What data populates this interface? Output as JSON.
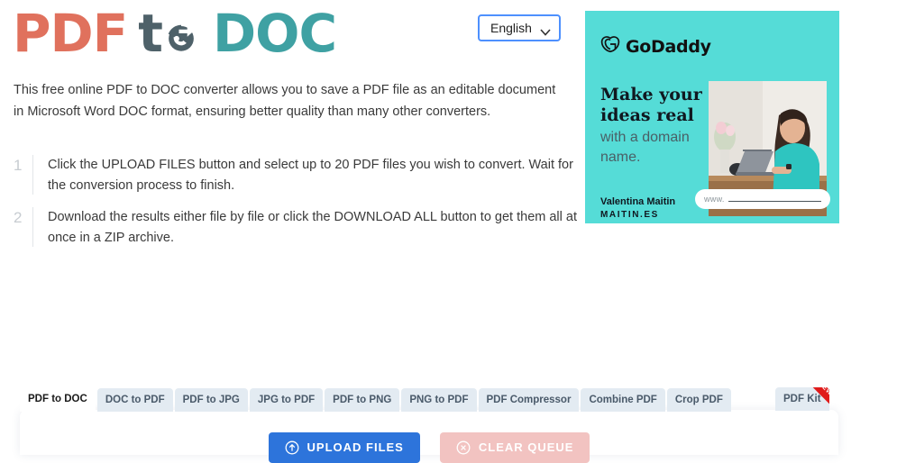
{
  "header": {
    "logo": {
      "part1": "PDF",
      "part2": "t",
      "icon": "convert-circle-icon",
      "part3": "DOC"
    },
    "language": {
      "selected": "English",
      "options": [
        "English"
      ],
      "caret": "˅"
    }
  },
  "intro": {
    "paragraph": "This free online PDF to DOC converter allows you to save a PDF file as an editable document in Microsoft Word DOC format, ensuring better quality than many other converters."
  },
  "steps": [
    {
      "number": "1",
      "text": "Click the UPLOAD FILES button and select up to 20 PDF files you wish to convert. Wait for the conversion process to finish."
    },
    {
      "number": "2",
      "text": "Download the results either file by file or click the DOWNLOAD ALL button to get them all at once in a ZIP archive."
    }
  ],
  "ad": {
    "brand": "GoDaddy",
    "brand_icon": "godaddy-heart-logo-icon",
    "headline": "Make your ideas real",
    "subtext": "with a domain name.",
    "author": "Valentina Maitin",
    "site": "MAITIN.ES",
    "search_prefix": "www.",
    "photo_alt": "woman-at-laptop-photo",
    "background_color": "#55dcd7"
  },
  "tabs": {
    "items": [
      {
        "label": "PDF to DOC",
        "active": true
      },
      {
        "label": "DOC to PDF",
        "active": false
      },
      {
        "label": "PDF to JPG",
        "active": false
      },
      {
        "label": "JPG to PDF",
        "active": false
      },
      {
        "label": "PDF to PNG",
        "active": false
      },
      {
        "label": "PNG to PDF",
        "active": false
      },
      {
        "label": "PDF Compressor",
        "active": false
      },
      {
        "label": "Combine PDF",
        "active": false
      },
      {
        "label": "Crop PDF",
        "active": false
      }
    ],
    "kit": {
      "label": "PDF Kit",
      "badge": "NEW",
      "badge_color": "#e01b1b"
    }
  },
  "actions": {
    "upload": {
      "label": "UPLOAD FILES",
      "icon": "upload-arrow-circle-icon",
      "color": "#2d74db"
    },
    "clear": {
      "label": "CLEAR QUEUE",
      "icon": "clear-x-circle-icon",
      "color": "#f2c3c1"
    }
  }
}
